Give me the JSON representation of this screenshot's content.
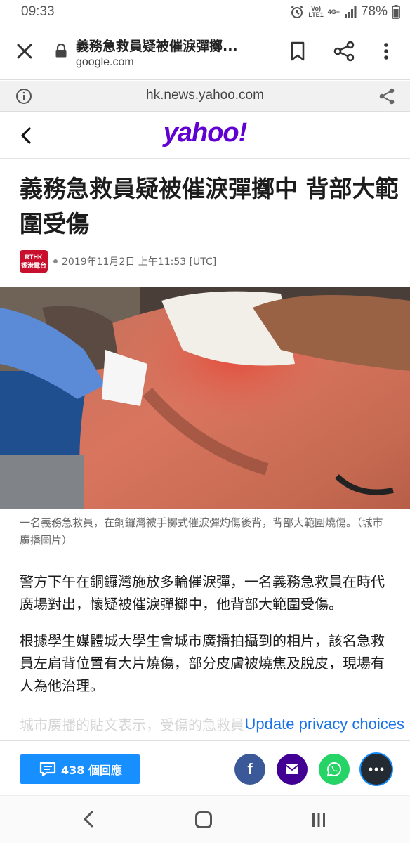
{
  "status_bar": {
    "time": "09:33",
    "network_line1": "Vo)",
    "network_line2": "LTE1",
    "network_gen": "4G+",
    "battery": "78%"
  },
  "tab": {
    "title": "義務急救員疑被催淚彈擲...",
    "domain": "google.com"
  },
  "url_bar": {
    "url": "hk.news.yahoo.com"
  },
  "site": {
    "logo": "yahoo!",
    "logo_color": "#6001d2"
  },
  "article": {
    "title": "義務急救員疑被催淚彈擲中 背部大範圍受傷",
    "source_logo_top": "RTHK",
    "source_logo_bottom": "香港電台",
    "date": "2019年11月2日 上午11:53 [UTC]",
    "caption": "一名義務急救員，在銅鑼灣被手擲式催淚彈灼傷後背，背部大範圍燒傷。（城市廣播圖片）",
    "paragraphs": [
      "警方下午在銅鑼灣施放多輪催淚彈，一名義務急救員在時代廣場對出，懷疑被催淚彈擲中，他背部大範圍受傷。",
      "根據學生媒體城大學生會城市廣播拍攝到的相片，該名急救員左肩背位置有大片燒傷，部分皮膚被燒焦及脫皮，現場有人為他治理。",
      "城市廣播的貼文表示，受傷的急救員"
    ],
    "privacy_link": "Update privacy choices"
  },
  "actions": {
    "comments_label": "438 個回應",
    "comments_color": "#188fff",
    "facebook_glyph": "f"
  }
}
